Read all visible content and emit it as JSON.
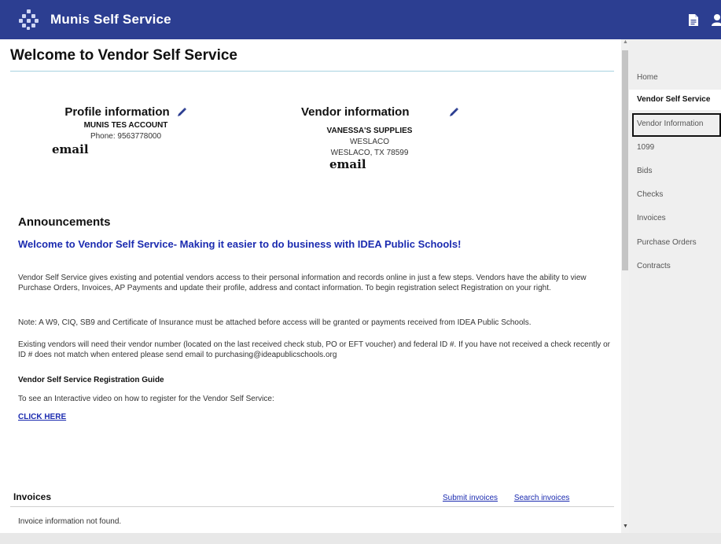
{
  "app": {
    "title": "Munis Self Service"
  },
  "header_icons": [
    {
      "name": "document-icon"
    },
    {
      "name": "user-icon"
    }
  ],
  "page": {
    "title": "Welcome to Vendor Self Service"
  },
  "profile": {
    "heading": "Profile information",
    "account_name": "MUNIS TES ACCOUNT",
    "phone": "Phone: 9563778000",
    "email_label": "email"
  },
  "vendor": {
    "heading": "Vendor information",
    "name": "VANESSA'S SUPPLIES",
    "city": "WESLACO",
    "city_state_zip": "WESLACO, TX 78599",
    "email_label": "email"
  },
  "announcements": {
    "heading": "Announcements",
    "welcome": "Welcome to Vendor Self Service- Making it easier to do business with IDEA Public Schools!",
    "para1": "Vendor Self Service gives existing and potential vendors access to their personal information and records online in just a few steps. Vendors have the ability to view Purchase Orders, Invoices, AP Payments and update their profile, address and contact information. To begin registration select Registration on your right.",
    "para2": "Note: A W9, CIQ, SB9 and Certificate of Insurance must be attached before access will be granted or payments received from IDEA Public Schools.",
    "para3": "Existing vendors will need their vendor number (located on the last received check stub, PO or EFT voucher) and federal ID #. If you have not received a check recently or ID # does not match when entered please send email to purchasing@ideapublicschools.org",
    "guide_heading": "Vendor Self Service Registration Guide",
    "video_text": "To see an Interactive video on how to register for the Vendor Self Service:",
    "click_here": "CLICK HERE"
  },
  "invoices": {
    "heading": "Invoices",
    "submit_link": "Submit invoices",
    "search_link": "Search invoices",
    "empty_message": "Invoice information not found."
  },
  "sidebar": {
    "items": [
      {
        "label": "Home",
        "active": false
      },
      {
        "label": "Vendor Self Service",
        "active": true
      },
      {
        "label": "Vendor Information",
        "active": false
      },
      {
        "label": "1099",
        "active": false
      },
      {
        "label": "Bids",
        "active": false
      },
      {
        "label": "Checks",
        "active": false
      },
      {
        "label": "Invoices",
        "active": false
      },
      {
        "label": "Purchase Orders",
        "active": false
      },
      {
        "label": "Contracts",
        "active": false
      }
    ]
  },
  "colors": {
    "header_bg": "#2c3e91",
    "link": "#1b2bb0",
    "sidebar_bg": "#efefef"
  }
}
